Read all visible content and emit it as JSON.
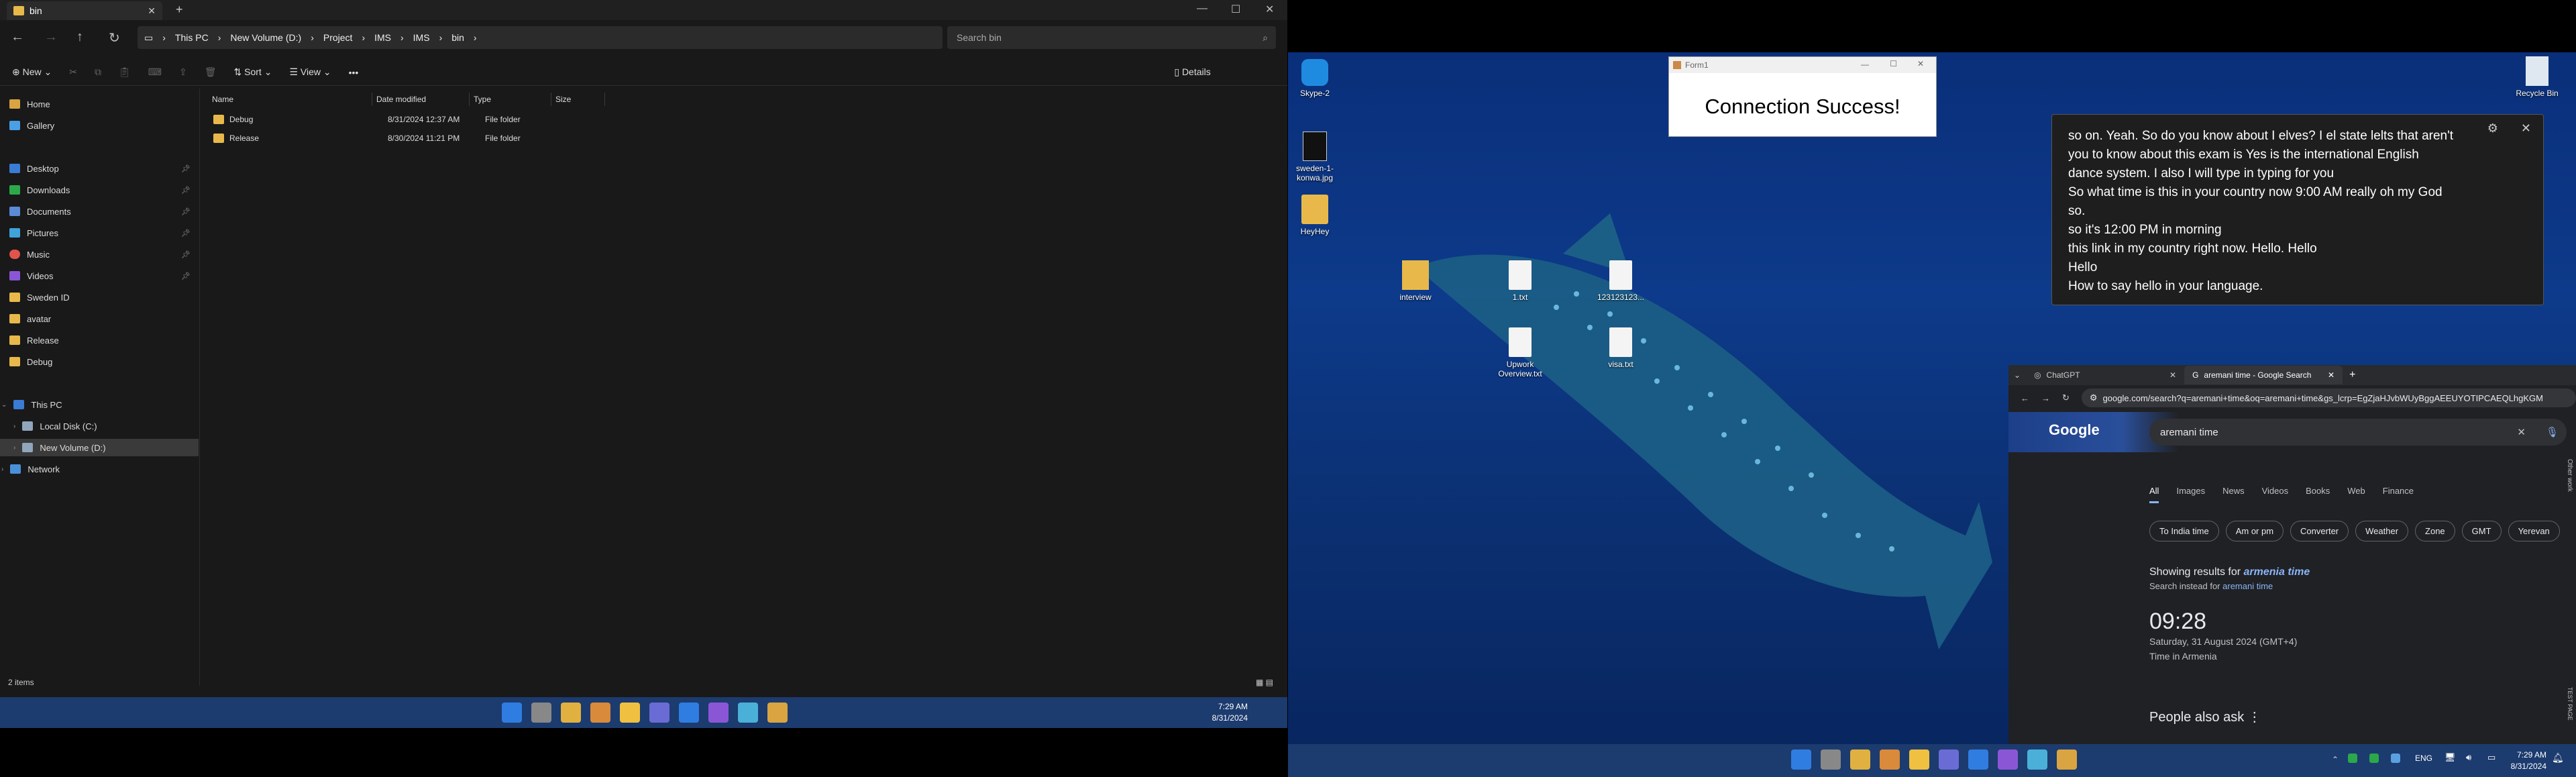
{
  "explorer": {
    "tab_title": "bin",
    "search_placeholder": "Search bin",
    "breadcrumb": [
      "This PC",
      "New Volume (D:)",
      "Project",
      "IMS",
      "IMS",
      "bin"
    ],
    "toolbar": {
      "new": "New",
      "sort": "Sort",
      "view": "View",
      "more": "•••",
      "details": "Details"
    },
    "nav": {
      "home": "Home",
      "gallery": "Gallery",
      "pinned": [
        "Desktop",
        "Downloads",
        "Documents",
        "Pictures",
        "Music",
        "Videos"
      ],
      "folders": [
        "Sweden ID",
        "avatar",
        "Release",
        "Debug"
      ],
      "this_pc": "This PC",
      "local_disk": "Local Disk (C:)",
      "new_volume": "New Volume (D:)",
      "network": "Network"
    },
    "columns": {
      "name": "Name",
      "date": "Date modified",
      "type": "Type",
      "size": "Size"
    },
    "files": [
      {
        "name": "Debug",
        "date": "8/31/2024 12:37 AM",
        "type": "File folder"
      },
      {
        "name": "Release",
        "date": "8/30/2024 11:21 PM",
        "type": "File folder"
      }
    ],
    "status": "2 items"
  },
  "left_taskbar": {
    "time": "7:29 AM",
    "date": "8/31/2024"
  },
  "desktop": {
    "icons": {
      "skype": "Skype-2",
      "sweden": "sweden-1-konwa.jpg",
      "heyhey": "HeyHey",
      "recycle": "Recycle Bin",
      "interview": "interview",
      "file1": "1.txt",
      "file123": "123123123...",
      "upwork": "Upwork Overview.txt",
      "visa": "visa.txt"
    },
    "form_title": "Form1",
    "form_message": "Connection Success!"
  },
  "captions": [
    "so on. Yeah. So do you know about I elves? I el state lelts that aren't",
    "you to know about this exam is Yes is the international English",
    "dance system. I also I will type in typing for you",
    "So what time is this in your country now 9:00 AM really oh my God",
    "so.",
    "so it's 12:00 PM in morning",
    "this link in my country right now. Hello. Hello",
    "Hello",
    "How to say hello in your language."
  ],
  "chrome": {
    "tab1": "ChatGPT",
    "tab2": "aremani time - Google Search",
    "url": "google.com/search?q=aremani+time&oq=aremani+time&gs_lcrp=EgZjaHJvbWUyBggAEEUYOTIPCAEQLhgKGM",
    "query": "aremani time",
    "tabs": [
      "All",
      "Images",
      "News",
      "Videos",
      "Books",
      "Web",
      "Finance"
    ],
    "chips": [
      "To India time",
      "Am or pm",
      "Converter",
      "Weather",
      "Zone",
      "GMT",
      "Yerevan"
    ],
    "showing_prefix": "Showing results for",
    "corrected": "armenia time",
    "instead_prefix": "Search instead for",
    "original": "aremani time",
    "clock": "09:28",
    "date_line": "Saturday, 31 August 2024 (GMT+4)",
    "place": "Time in Armenia",
    "paa": "People also ask",
    "side_label": "Other work",
    "side_label2": "TEST PAGE"
  },
  "right_taskbar": {
    "lang": "ENG",
    "time": "7:29 AM",
    "date": "8/31/2024"
  }
}
